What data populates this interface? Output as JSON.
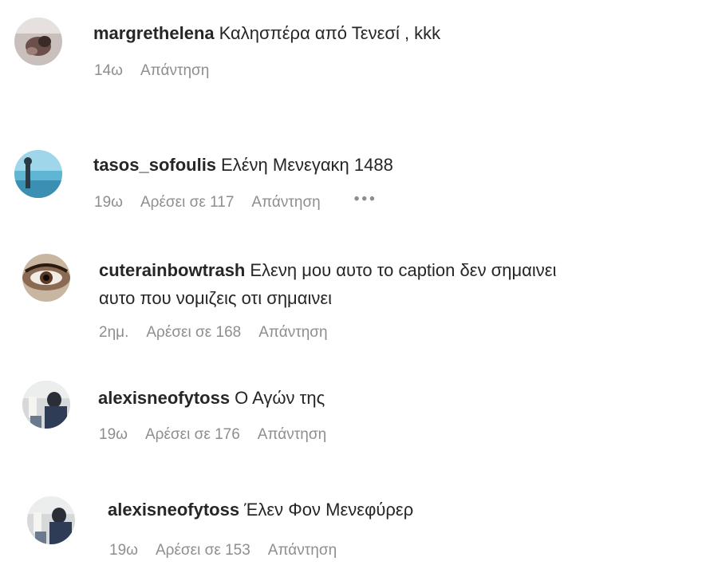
{
  "comments": [
    {
      "username": "margrethelena",
      "text": "Καλησπέρα από Τενεσί , kkk",
      "time": "14ω",
      "likes": "",
      "reply": "Απάντηση",
      "avatar": "avatar-icon"
    },
    {
      "username": "tasos_sofoulis",
      "text": "Ελένη Μενεγακη 1488",
      "time": "19ω",
      "likes": "Αρέσει σε 117",
      "reply": "Απάντηση",
      "more": "•••",
      "avatar": "avatar-icon"
    },
    {
      "username": "cuterainbowtrash",
      "text": "Ελενη μου αυτο το caption δεν σημαινει",
      "text2": "αυτο που νομιζεις οτι σημαινει",
      "time": "2ημ.",
      "likes": "Αρέσει σε 168",
      "reply": "Απάντηση",
      "avatar": "avatar-icon"
    },
    {
      "username": "alexisneofytoss",
      "text": "Ο Αγών της",
      "time": "19ω",
      "likes": "Αρέσει σε 176",
      "reply": "Απάντηση",
      "avatar": "avatar-icon"
    },
    {
      "username": "alexisneofytoss",
      "text": "Έλεν Φον Μενεφύρερ",
      "time": "19ω",
      "likes": "Αρέσει σε 153",
      "reply": "Απάντηση",
      "avatar": "avatar-icon"
    }
  ]
}
